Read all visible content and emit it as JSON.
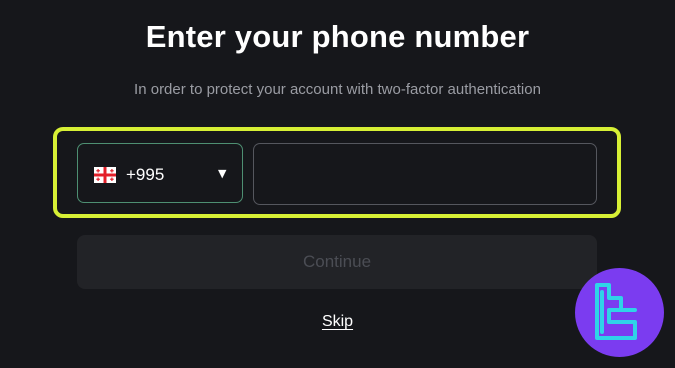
{
  "header": {
    "title": "Enter your phone number",
    "subtitle": "In order to protect your account with two-factor authentication"
  },
  "phone_form": {
    "country": {
      "flag": "georgia-flag",
      "dial_code": "+995",
      "arrow": "▼"
    },
    "phone_value": "",
    "continue_label": "Continue",
    "skip_label": "Skip"
  },
  "colors": {
    "background": "#16171b",
    "highlight": "#d7f035",
    "country_border": "#4e8f72",
    "button_bg": "#222327",
    "button_text": "#4b4d54",
    "logo_bg": "#7b3cf0",
    "logo_stroke": "#2fd3e8"
  },
  "icons": {
    "flag": "georgia-flag-icon",
    "dropdown": "caret-down-icon",
    "watermark": "tradingfinder-logo-icon"
  }
}
